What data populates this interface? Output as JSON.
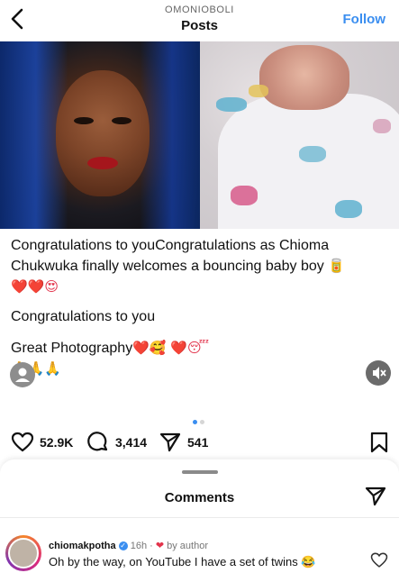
{
  "header": {
    "username": "OMONIOBOLI",
    "title": "Posts",
    "follow_label": "Follow"
  },
  "post": {
    "caption": {
      "line1": "Congratulations to youCongratulations as Chioma",
      "line2": "Chukwuka finally welcomes a bouncing baby boy",
      "line2_emoji": "🥫",
      "line3_emojis": "❤️❤️😍",
      "line4": "Congratulations to you",
      "line5": "Great Photography",
      "line5_emojis": "❤️🥰 ❤️😴",
      "line6_emojis": "🙏🙏🙏"
    },
    "carousel": {
      "total": 2,
      "current": 1
    },
    "stats": {
      "likes": "52.9K",
      "comments": "3,414",
      "shares": "541"
    }
  },
  "comments_sheet": {
    "title": "Comments",
    "comments": [
      {
        "username": "chiomakpotha",
        "verified": true,
        "time": "16h",
        "by_author": "by author",
        "text": "Oh by the way, on YouTube I have a set of twins 😂"
      }
    ]
  },
  "icons": {
    "back": "chevron-left-icon",
    "like": "heart-icon",
    "comment": "comment-icon",
    "share": "send-icon",
    "save": "bookmark-icon",
    "mute": "speaker-muted-icon",
    "user_tag": "person-icon"
  },
  "colors": {
    "accent": "#3a8ef0",
    "heart": "#e2334b"
  }
}
